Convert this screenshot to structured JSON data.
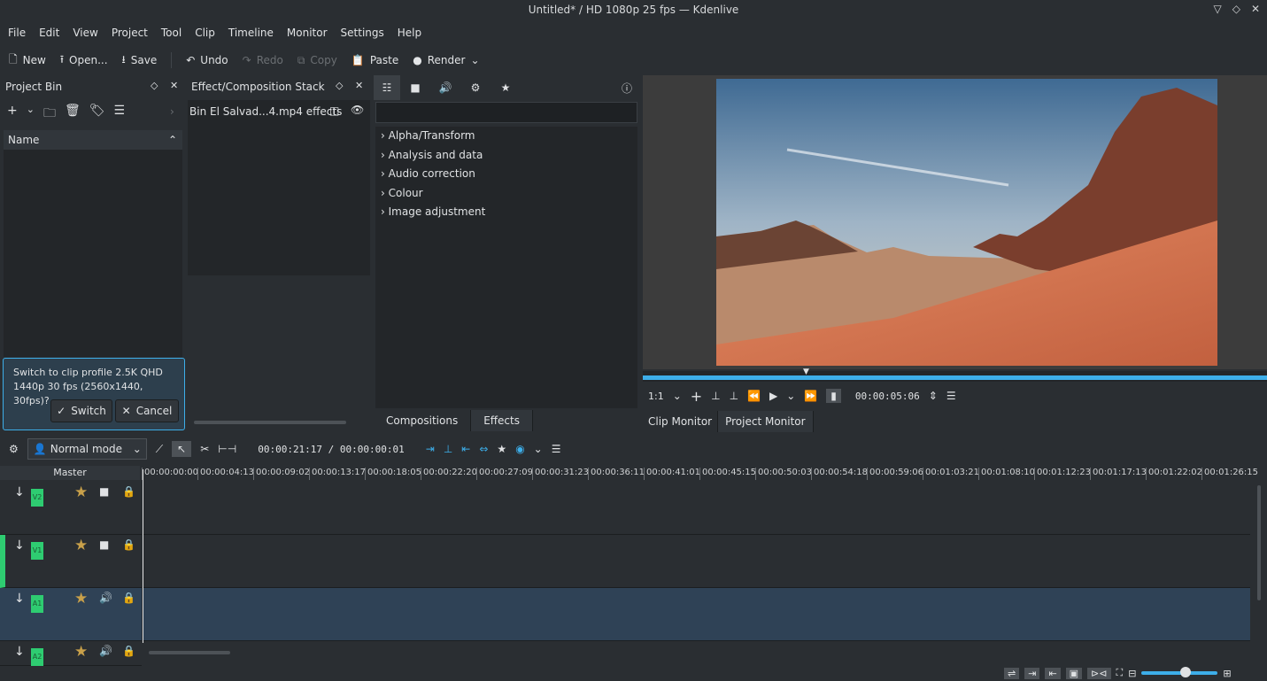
{
  "window": {
    "title": "Untitled* / HD 1080p 25 fps — Kdenlive"
  },
  "menu": [
    "File",
    "Edit",
    "View",
    "Project",
    "Tool",
    "Clip",
    "Timeline",
    "Monitor",
    "Settings",
    "Help"
  ],
  "toolbar": {
    "new": "New",
    "open": "Open...",
    "save": "Save",
    "undo": "Undo",
    "redo": "Redo",
    "copy": "Copy",
    "paste": "Paste",
    "render": "Render"
  },
  "project_bin": {
    "title": "Project Bin",
    "column_name": "Name",
    "prompt": "Switch to clip profile 2.5K QHD 1440p 30 fps (2560x1440, 30fps)?",
    "switch_label": "Switch",
    "cancel_label": "Cancel"
  },
  "effect_stack": {
    "title": "Effect/Composition Stack",
    "clip_label": "Bin El Salvad...4.mp4 effects"
  },
  "effects": {
    "categories": [
      "Alpha/Transform",
      "Analysis and data",
      "Audio correction",
      "Colour",
      "Image adjustment"
    ],
    "tabs": [
      "Compositions",
      "Effects"
    ]
  },
  "monitor": {
    "zoom": "1:1",
    "timecode": "00:00:05:06",
    "tabs": [
      "Clip Monitor",
      "Project Monitor"
    ]
  },
  "timeline": {
    "mode": "Normal mode",
    "position": "00:00:21:17 / 00:00:00:01",
    "master_label": "Master",
    "ticks": [
      "00:00:00:00",
      "00:00:04:13",
      "00:00:09:02",
      "00:00:13:17",
      "00:00:18:05",
      "00:00:22:20",
      "00:00:27:09",
      "00:00:31:23",
      "00:00:36:11",
      "00:00:41:01",
      "00:00:45:15",
      "00:00:50:03",
      "00:00:54:18",
      "00:00:59:06",
      "00:01:03:21",
      "00:01:08:10",
      "00:01:12:23",
      "00:01:17:13",
      "00:01:22:02",
      "00:01:26:15"
    ],
    "tracks": [
      {
        "name": "V2",
        "type": "video"
      },
      {
        "name": "V1",
        "type": "video"
      },
      {
        "name": "A1",
        "type": "audio"
      },
      {
        "name": "A2",
        "type": "audio"
      }
    ]
  },
  "colors": {
    "accent": "#3daee9",
    "track_tag": "#2ecc71",
    "star": "#c8a04a",
    "audio_lane": "#2f4256"
  }
}
